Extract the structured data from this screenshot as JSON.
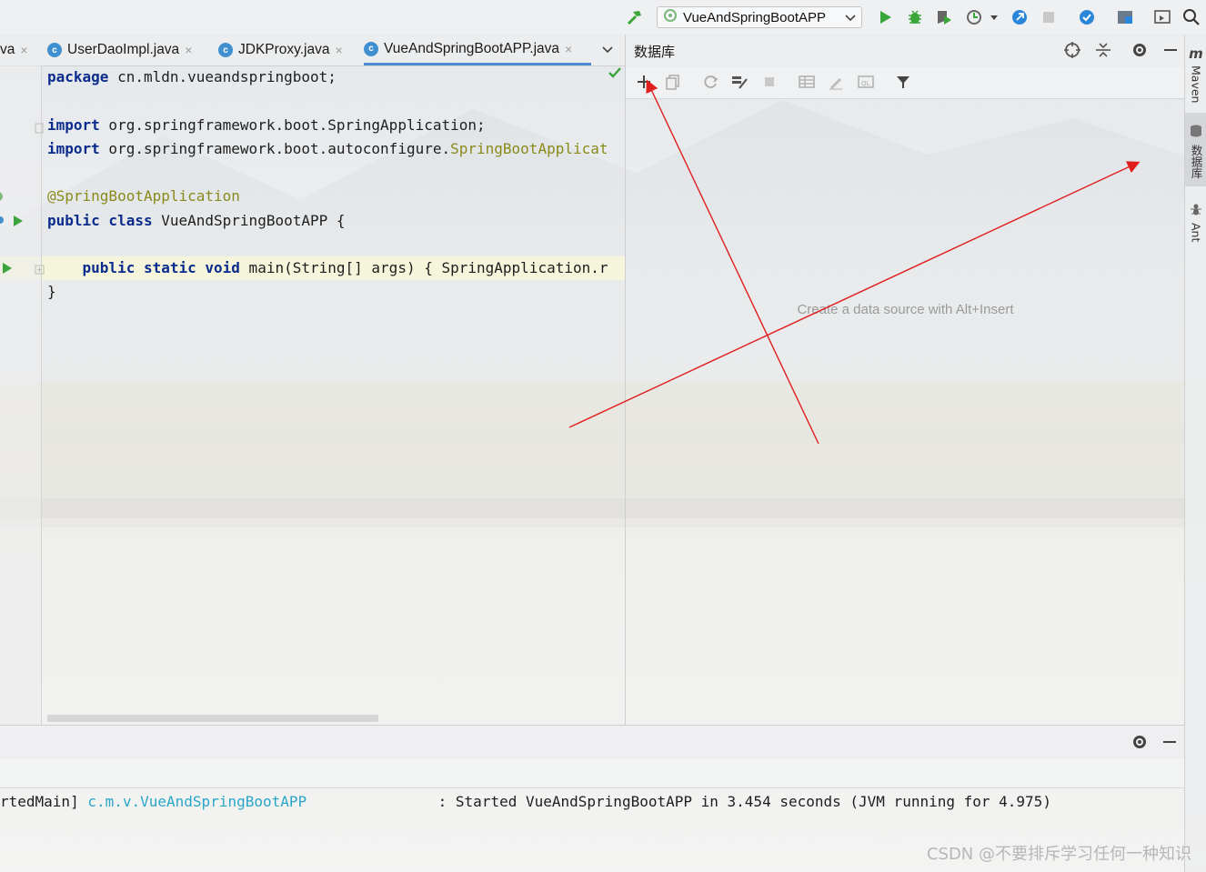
{
  "toolbar": {
    "run_config_label": "VueAndSpringBootAPP"
  },
  "tabs": [
    {
      "label": "va",
      "icon": "class-icon"
    },
    {
      "label": "UserDaoImpl.java",
      "icon": "class-icon"
    },
    {
      "label": "JDKProxy.java",
      "icon": "class-icon"
    },
    {
      "label": "VueAndSpringBootAPP.java",
      "icon": "springboot-class-icon",
      "active": true
    }
  ],
  "editor": {
    "lines": {
      "l1_kw": "package",
      "l1_rest": " cn.mldn.vueandspringboot;",
      "l3_kw": "import",
      "l3_rest": " org.springframework.boot.SpringApplication;",
      "l4_kw": "import",
      "l4_rest": " org.springframework.boot.autoconfigure.",
      "l4_hl": "SpringBootApplicat",
      "l6_ann": "@SpringBootApplication",
      "l7_kw": "public class",
      "l7_rest": " VueAndSpringBootAPP {",
      "l9_indent": "    ",
      "l9_kw": "public static void",
      "l9_rest": " main(String[] args) { SpringApplication.r",
      "l10": "}"
    }
  },
  "db_panel": {
    "title": "数据库",
    "empty_text": "Create a data source with Alt+Insert"
  },
  "right_stripe": {
    "maven": "Maven",
    "database": "数据库",
    "ant": "Ant"
  },
  "console": {
    "thread": "rtedMain] ",
    "logger": "c.m.v.VueAndSpringBootAPP",
    "message": "               : Started VueAndSpringBootAPP in 3.454 seconds (JVM running for 4.975)"
  },
  "watermark": "CSDN @不要排斥学习任何一种知识",
  "colors": {
    "annotation_arrow": "#e01e1e",
    "keyword": "#0b2c8c",
    "run_green": "#3aa53a",
    "logger_cyan": "#2aa6c9"
  }
}
